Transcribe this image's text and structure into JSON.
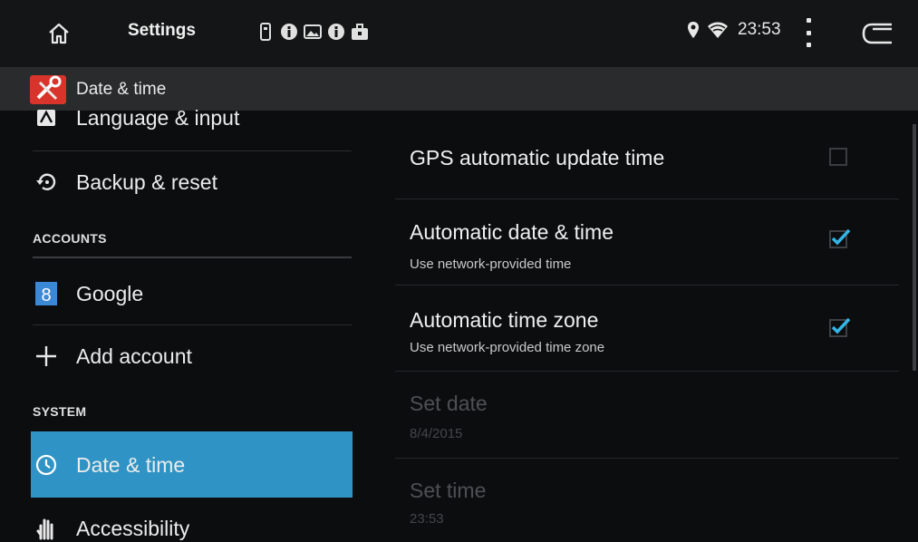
{
  "status_bar": {
    "title": "Settings",
    "time": "23:53",
    "notification_icons": [
      "sd-card-icon",
      "info-icon",
      "image-icon",
      "info-icon",
      "briefcase-icon"
    ]
  },
  "app_bar": {
    "title": "Date & time"
  },
  "sidebar": {
    "items_top": [
      {
        "label": "Language & input",
        "icon": "language-icon"
      },
      {
        "label": "Backup & reset",
        "icon": "backup-icon"
      }
    ],
    "accounts_header": "ACCOUNTS",
    "accounts": [
      {
        "label": "Google",
        "icon": "google-icon"
      },
      {
        "label": "Add account",
        "icon": "plus-icon"
      }
    ],
    "system_header": "SYSTEM",
    "system": [
      {
        "label": "Date & time",
        "icon": "clock-icon",
        "selected": true
      },
      {
        "label": "Accessibility",
        "icon": "hand-icon"
      }
    ]
  },
  "preferences": [
    {
      "title": "GPS automatic update time",
      "summary": "",
      "checked": false,
      "enabled": true
    },
    {
      "title": "Automatic date & time",
      "summary": "Use network-provided time",
      "checked": true,
      "enabled": true
    },
    {
      "title": "Automatic time zone",
      "summary": "Use network-provided time zone",
      "checked": true,
      "enabled": true
    },
    {
      "title": "Set date",
      "summary": "8/4/2015",
      "enabled": false
    },
    {
      "title": "Set time",
      "summary": "23:53",
      "enabled": false
    }
  ],
  "colors": {
    "accent": "#2f94c5",
    "checkbox": "#33b5e5",
    "background": "#0c0d0f"
  }
}
